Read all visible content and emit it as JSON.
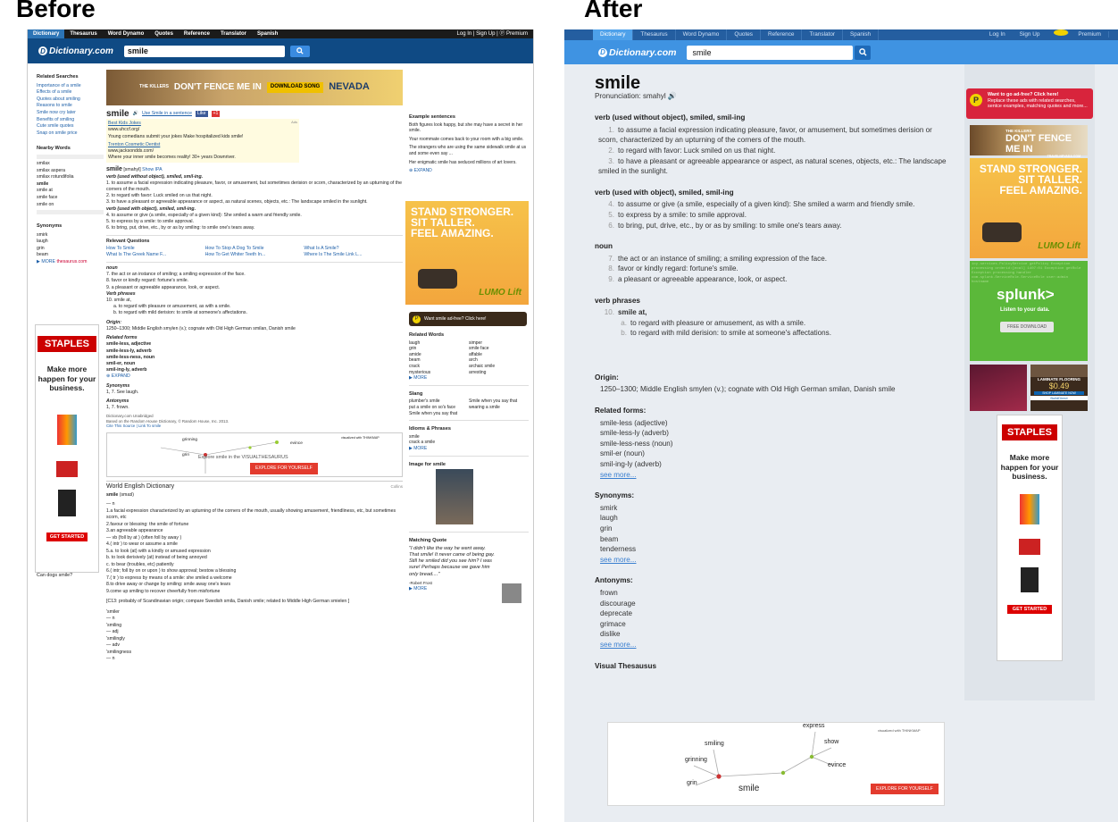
{
  "captions": {
    "before": "Before",
    "after": "After"
  },
  "before": {
    "nav": {
      "tabs": [
        "Dictionary",
        "Thesaurus",
        "Word Dynamo",
        "Quotes",
        "Reference",
        "Translator",
        "Spanish"
      ],
      "user": "Log In | Sign Up | ⓟ Premium"
    },
    "logo": "Dictionary.com",
    "search_value": "smile",
    "left": {
      "related_title": "Related Searches",
      "related": [
        "Importance of a smile",
        "Effects of a smile",
        "Quotes about smiling",
        "Reasons to smile",
        "Smile now cry later",
        "Benefits of smiling",
        "Cute smile quotes",
        "Snap on smile price"
      ],
      "nearby_title": "Nearby Words",
      "nearby": [
        "smilax",
        "smilax aspera",
        "smilax rotundifolia",
        "smile",
        "smile at",
        "smile face",
        "smile on"
      ],
      "synonyms_title": "Synonyms",
      "synonyms": [
        "smirk",
        "laugh",
        "grin",
        "beam"
      ],
      "more": "▶ MORE",
      "thesaurus": "thesaurus.com",
      "question": "Can dogs smile?"
    },
    "ad_banner": {
      "brand": "THE KILLERS",
      "headline": "DON'T FENCE ME IN",
      "cta": "DOWNLOAD SONG",
      "right": "NEVADA",
      "site": "TRAVELNEVADA.COM"
    },
    "headword": {
      "word": "smile",
      "ipa": "Use Smile in a sentence",
      "like": "Like",
      "gplus": "+1"
    },
    "ads_label": "Ads",
    "ad_text": [
      {
        "title": "Best Kids Jokes",
        "url": "www.uhccf.org/",
        "desc": "Young comedians submit your jokes Make hospitalized kids smile!"
      },
      {
        "title": "Trenton Cosmetic Dentist",
        "url": "www.jacksondds.com/",
        "desc": "Where your inner smile becomes reality! 30+ years Downriver."
      }
    ],
    "entry_head": "smile",
    "entry_pron": "[smahyl]",
    "show_ipa": "Show IPA",
    "v1": "verb (used without object), smiled, smil-ing.",
    "v1d": [
      "1. to assume a facial expression indicating pleasure, favor, or amusement, but sometimes derision or scorn, characterized by an upturning of the corners of the mouth.",
      "2. to regard with favor: Luck smiled on us that night.",
      "3. to have a pleasant or agreeable appearance or aspect, as natural scenes, objects, etc.: The landscape smiled in the sunlight."
    ],
    "v2": "verb (used with object), smiled, smil-ing.",
    "v2d": [
      "4. to assume or give (a smile, especially of a given kind): She smiled a warm and friendly smile.",
      "5. to express by a smile: to smile approval.",
      "6. to bring, put, drive, etc., by or as by smiling: to smile one's tears away."
    ],
    "rq_title": "Relevant Questions",
    "rq": [
      "How To Smile",
      "How To Stop A Dog To Smile",
      "What Is A Smile?",
      "What Is The Greek Name F...",
      "How To Get Whiter Teeth In...",
      "Where Is The Smile Link L..."
    ],
    "noun": "noun",
    "nd": [
      "7. the act or an instance of smiling; a smiling expression of the face.",
      "8. favor or kindly regard: fortune's smile.",
      "9. a pleasant or agreeable appearance, look, or aspect."
    ],
    "vp": "Verb phrases",
    "vpd": [
      "10. smile at,",
      "a. to regard with pleasure or amusement, as with a smile.",
      "b. to regard with mild derision: to smile at someone's affectations."
    ],
    "origin_t": "Origin:",
    "origin": "1250–1300; Middle English smylen (v.); cognate with Old High German smilan, Danish smile",
    "rf_t": "Related forms",
    "rf": [
      "smile-less, adjective",
      "smile-less-ly, adverb",
      "smile-less-ness, noun",
      "smil-er, noun",
      "smil-ing-ly, adverb"
    ],
    "expand": "EXPAND",
    "syn_t": "Synonyms",
    "syn": "1, 7. See laugh.",
    "ant_t": "Antonyms",
    "ant": "1, 7. frown.",
    "credit": [
      "Dictionary.com Unabridged",
      "Based on the Random House Dictionary, © Random House, Inc. 2013.",
      "Cite This Source | Link To smile"
    ],
    "vt": {
      "words": [
        "grinning",
        "grin",
        "evince"
      ],
      "explore": "Explore smile in the VISUALTHESAURUS",
      "button": "EXPLORE FOR YOURSELF",
      "by": "visualized with THINKMAP"
    },
    "wed": {
      "title": "World English Dictionary",
      "src": "Collins",
      "word": "smile",
      "pron": "(smaɪl)",
      "lines": [
        "— n",
        "1.a facial expression characterized by an upturning of the corners of the mouth, usually showing amusement, friendliness, etc, but sometimes scorn, etc",
        "2.favour or blessing: the smile of fortune",
        "3.an agreeable appearance",
        "— vb (foll by at ) (often foll by away )",
        "4.( intr ) to wear or assume a smile",
        "5.a. to look (at) with a kindly or amused expression",
        "  b. to look derisively (at) instead of being annoyed",
        "  c. to bear (troubles, etc) patiently",
        "6.( intr; foll by on or upon ) to show approval; bestow a blessing",
        "7.( tr ) to express by means of a smile: she smiled a welcome",
        "8.to drive away or change by smiling: smile away one's tears",
        "9.come up smiling to recover cheerfully from misfortune",
        "",
        "[C13: probably of Scandinavian origin; compare Swedish smila, Danish smile; related to Middle High German smielen ]",
        "",
        "'smiler",
        "— n",
        "'smiling",
        "— adj",
        "'smilingly",
        "— adv",
        "'smilingness",
        "— n"
      ]
    },
    "right": {
      "ex_t": "Example sentences",
      "ex": [
        "Both figures look happy, but she may have a secret in her smile.",
        "Your roommate comes back to your room with a big smile.",
        "The strangers who are using the same sidewalk smile at us and some even say ...",
        "Her enigmatic smile has seduced millions of art lovers."
      ],
      "adfree": "Want smile ad-free? Click here!",
      "rw_t": "Related Words",
      "rw": [
        "laugh",
        "simper",
        "grin",
        "smile face",
        "amide",
        "affable",
        "beam",
        "arch",
        "crack",
        "archaic smile",
        "mysterious",
        "arresting"
      ],
      "slang_t": "Slang",
      "slang": [
        "plumber's smile",
        "Smile when you say that",
        "put a smile on so's face",
        "wearing a smile",
        "Smile when you say that"
      ],
      "idioms_t": "Idioms & Phrases",
      "idioms": [
        "smile",
        "crack a smile"
      ],
      "img_t": "Image for smile",
      "mq_t": "Matching Quote",
      "mq": "\"I didn't like the way he went away. That smile! It never came of being gay. Still he smiled did you see him? I was sure! Perhaps because we gave him only bread....\"",
      "mq_by": "-Robert Frost"
    },
    "lumo": {
      "text": [
        "STAND STRONGER.",
        "SIT TALLER.",
        "FEEL AMAZING."
      ],
      "brand": "LUMO Lift"
    },
    "staples": {
      "logo": "STAPLES",
      "text": "Make more happen for your business.",
      "cta": "GET STARTED"
    }
  },
  "after": {
    "nav": {
      "tabs": [
        "Dictionary",
        "Thesaurus",
        "Word Dynamo",
        "Quotes",
        "Reference",
        "Translator",
        "Spanish"
      ],
      "login": "Log In",
      "signup": "Sign Up",
      "premium": "Premium"
    },
    "logo": "Dictionary.com",
    "search_value": "smile",
    "word": "smile",
    "pron_label": "Pronunciation:",
    "pron": "smahyl",
    "v1": "verb (used without object), smiled, smil-ing",
    "v1d": [
      [
        "1.",
        "to assume a facial expression indicating pleasure, favor, or amusement, but sometimes derision or scorn, characterized by an upturning of the corners of the mouth."
      ],
      [
        "2.",
        "to regard with favor: Luck smiled on us that night."
      ],
      [
        "3.",
        "to have a pleasant or agreeable appearance or aspect, as natural scenes, objects, etc.: The landscape smiled in the sunlight."
      ]
    ],
    "v2": "verb (used with object), smiled, smil-ing",
    "v2d": [
      [
        "4.",
        "to assume or give (a smile, especially of a given kind): She smiled a warm and friendly smile."
      ],
      [
        "5.",
        "to express by a smile: to smile approval."
      ],
      [
        "6.",
        "to bring, put, drive, etc., by or as by smiling: to smile one's tears away."
      ]
    ],
    "noun": "noun",
    "nd": [
      [
        "7.",
        "the act or an instance of smiling; a smiling expression of the face."
      ],
      [
        "8.",
        "favor or kindly regard: fortune's smile."
      ],
      [
        "9.",
        "a pleasant or agreeable appearance, look, or aspect."
      ]
    ],
    "vp": "verb phrases",
    "vp10": "smile at,",
    "vpd": [
      [
        "a.",
        "to regard with pleasure or amusement, as with a smile."
      ],
      [
        "b.",
        "to regard with mild derision: to smile at someone's affectations."
      ]
    ],
    "origin_t": "Origin:",
    "origin": "1250–1300; Middle English smylen (v.); cognate with Old High German smilan, Danish smile",
    "rf_t": "Related forms:",
    "rf": [
      "smile-less (adjective)",
      "smile-less-ly (adverb)",
      "smile-less-ness (noun)",
      "smil-er (noun)",
      "smil-ing-ly (adverb)"
    ],
    "syn_t": "Synonyms:",
    "syn": [
      "smirk",
      "laugh",
      "grin",
      "beam",
      "tenderness"
    ],
    "ant_t": "Antonyms:",
    "ant": [
      "frown",
      "discourage",
      "deprecate",
      "grimace",
      "dislike"
    ],
    "see_more": "see more...",
    "vt_t": "Visual Thesausus",
    "vt": {
      "words": [
        "express",
        "smiling",
        "show",
        "grinning",
        "evince",
        "grin",
        "smile"
      ],
      "button": "EXPLORE FOR YOURSELF",
      "by": "visualized with THINKMAP"
    },
    "adfree": {
      "title": "Want to go ad-free? Click here!",
      "text": "Replace these ads with related searches, sentce examples, matching quotes and more..."
    },
    "killers": {
      "brand": "THE KILLERS",
      "headline": "DON'T FENCE ME IN",
      "site": "TRAVELNEVADA.COM"
    },
    "lumo": {
      "text": [
        "STAND STRONGER.",
        "SIT TALLER.",
        "FEEL AMAZING."
      ],
      "brand": "LUMO Lift"
    },
    "splunk": {
      "brand": "splunk>",
      "tag": "Listen to your data.",
      "cta": "FREE DOWNLOAD"
    },
    "laminate": {
      "title": "LAMINATE FLOORING",
      "price": "$0.49",
      "cta": "SHOP LAMINATE NOW",
      "brand": "BuildDirect"
    },
    "staples": {
      "logo": "STAPLES",
      "text": "Make more happen for your business.",
      "cta": "GET STARTED"
    }
  }
}
